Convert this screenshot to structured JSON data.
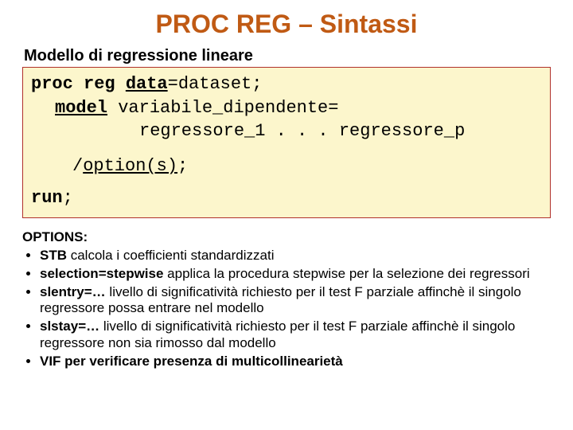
{
  "title": "PROC REG – Sintassi",
  "subtitle": "Modello di regressione lineare",
  "code": {
    "proc": "proc reg",
    "data_kw": "data",
    "data_rest": "=dataset;",
    "model_kw": "model",
    "model_rest": " variabile_dipendente=",
    "regressors": "regressore_1 . . . regressore_p",
    "slash": "/",
    "option": "option(s)",
    "semi": ";",
    "run": "run",
    "run_semi": ";"
  },
  "options_header": "OPTIONS:",
  "options": [
    {
      "bold": "STB",
      "rest": " calcola i coefficienti standardizzati"
    },
    {
      "bold": "selection=stepwise",
      "rest": "   applica la procedura stepwise per la selezione dei regressori"
    },
    {
      "bold": "slentry=…",
      "rest": " livello di significatività richiesto per il test F parziale affinchè il singolo regressore possa entrare nel modello"
    },
    {
      "bold": "slstay=…",
      "rest": " livello di significatività richiesto per il test F parziale affinchè il singolo regressore non sia rimosso dal modello"
    },
    {
      "bold": "VIF per verificare presenza di multicollinearietà",
      "rest": ""
    }
  ]
}
